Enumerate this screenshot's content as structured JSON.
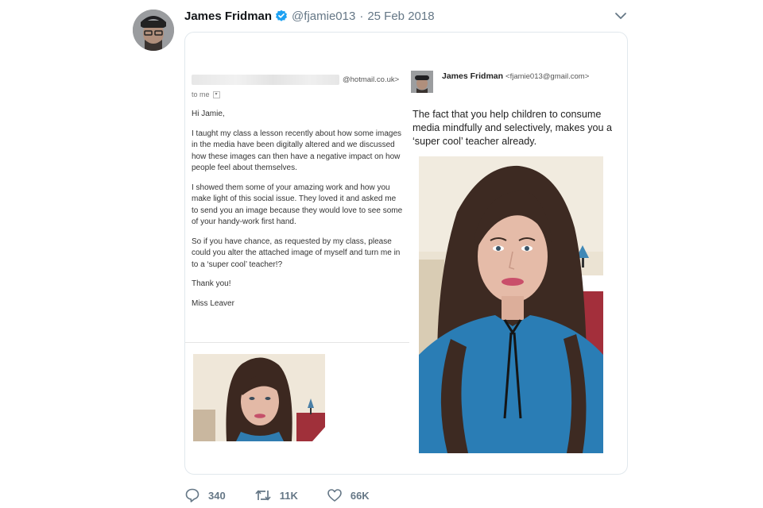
{
  "tweet": {
    "author": {
      "name": "James Fridman",
      "verified": true,
      "handle": "@fjamie013",
      "separator": "·",
      "date": "25 Feb 2018"
    },
    "menu_icon": "chevron-down-icon",
    "media": {
      "email": {
        "sender_domain": "@hotmail.co.uk>",
        "recipient": "to me",
        "paragraphs": [
          "Hi Jamie,",
          "I taught my class a lesson recently about how some images in the media have been digitally altered and we discussed how these images can then have a negative impact on how people feel about themselves.",
          "I showed them some of your amazing work and how you make light of this social issue. They loved it and asked me to send you an image because they would love to see some of your handy-work first hand.",
          "So if you have chance, as requested by my class, please could you alter the attached image of myself and turn me in to a ‘super cool’ teacher!?",
          "Thank you!",
          "Miss Leaver"
        ]
      },
      "reply": {
        "name": "James Fridman",
        "email": "<fjamie013@gmail.com>",
        "text": "The fact that you help children to consume media mindfully and selectively, makes you a ‘super cool’ teacher already."
      }
    },
    "actions": {
      "replies": "340",
      "retweets": "11K",
      "likes": "66K"
    }
  },
  "colors": {
    "verified_badge": "#1da1f2",
    "muted_text": "#657786",
    "border": "#e1e8ed"
  }
}
